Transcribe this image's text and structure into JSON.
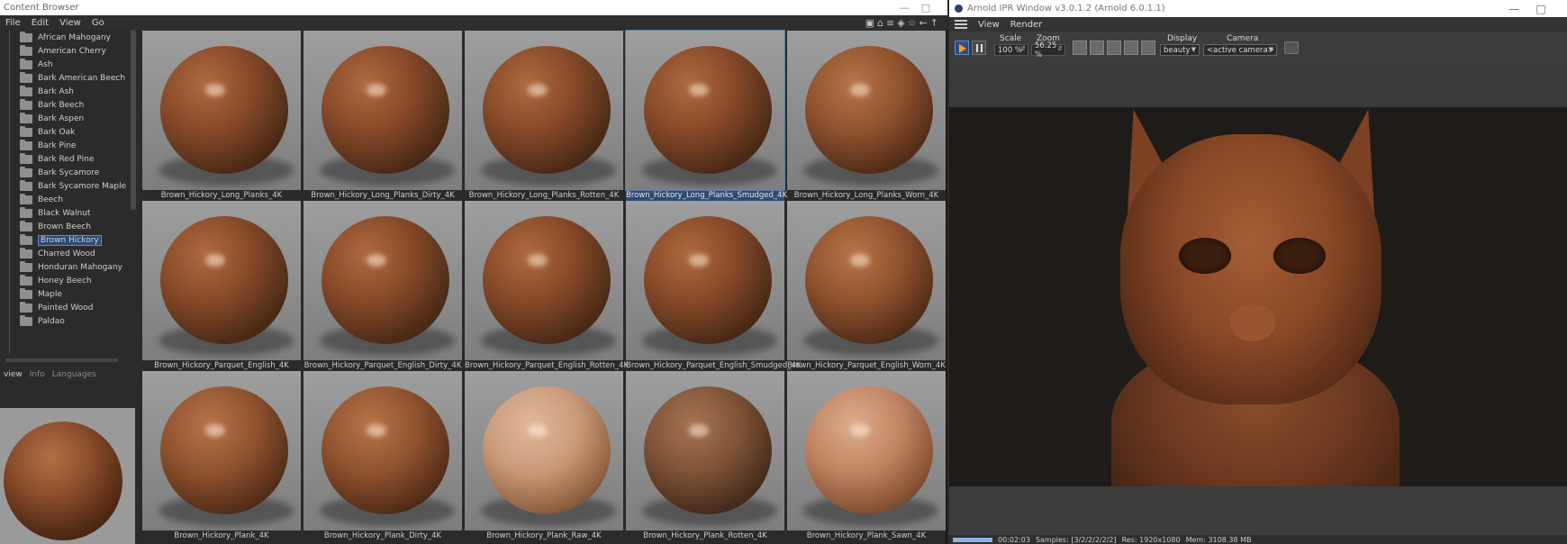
{
  "content_browser": {
    "title": "Content Browser",
    "menu": [
      "File",
      "Edit",
      "View",
      "Go"
    ],
    "tree_items": [
      {
        "label": "African Mahogany",
        "selected": false
      },
      {
        "label": "American Cherry",
        "selected": false
      },
      {
        "label": "Ash",
        "selected": false
      },
      {
        "label": "Bark American Beech",
        "selected": false
      },
      {
        "label": "Bark Ash",
        "selected": false
      },
      {
        "label": "Bark Beech",
        "selected": false
      },
      {
        "label": "Bark Aspen",
        "selected": false
      },
      {
        "label": "Bark Oak",
        "selected": false
      },
      {
        "label": "Bark Pine",
        "selected": false
      },
      {
        "label": "Bark Red Pine",
        "selected": false
      },
      {
        "label": "Bark Sycamore",
        "selected": false
      },
      {
        "label": "Bark Sycamore Maple",
        "selected": false
      },
      {
        "label": "Beech",
        "selected": false
      },
      {
        "label": "Black Walnut",
        "selected": false
      },
      {
        "label": "Brown Beech",
        "selected": false
      },
      {
        "label": "Brown Hickory",
        "selected": true
      },
      {
        "label": "Charred Wood",
        "selected": false
      },
      {
        "label": "Honduran Mahogany",
        "selected": false
      },
      {
        "label": "Honey Beech",
        "selected": false
      },
      {
        "label": "Maple",
        "selected": false
      },
      {
        "label": "Painted Wood",
        "selected": false
      },
      {
        "label": "Paldao",
        "selected": false
      }
    ],
    "panel_tabs": [
      "view",
      "Info",
      "Languages"
    ],
    "assets": [
      {
        "name": "Brown_Hickory_Long_Planks_4K",
        "selected": false,
        "tone": "dark"
      },
      {
        "name": "Brown_Hickory_Long_Planks_Dirty_4K",
        "selected": false,
        "tone": "dark"
      },
      {
        "name": "Brown_Hickory_Long_Planks_Rotten_4K",
        "selected": false,
        "tone": "dark"
      },
      {
        "name": "Brown_Hickory_Long_Planks_Smudged_4K",
        "selected": true,
        "tone": "dark"
      },
      {
        "name": "Brown_Hickory_Long_Planks_Worn_4K",
        "selected": false,
        "tone": "mid"
      },
      {
        "name": "Brown_Hickory_Parquet_English_4K",
        "selected": false,
        "tone": "dark"
      },
      {
        "name": "Brown_Hickory_Parquet_English_Dirty_4K",
        "selected": false,
        "tone": "dark"
      },
      {
        "name": "Brown_Hickory_Parquet_English_Rotten_4K",
        "selected": false,
        "tone": "dark"
      },
      {
        "name": "Brown_Hickory_Parquet_English_Smudged_4K",
        "selected": false,
        "tone": "dark"
      },
      {
        "name": "Brown_Hickory_Parquet_English_Worn_4K",
        "selected": false,
        "tone": "mid"
      },
      {
        "name": "Brown_Hickory_Plank_4K",
        "selected": false,
        "tone": "mid"
      },
      {
        "name": "Brown_Hickory_Plank_Dirty_4K",
        "selected": false,
        "tone": "mid"
      },
      {
        "name": "Brown_Hickory_Plank_Raw_4K",
        "selected": false,
        "tone": "raw"
      },
      {
        "name": "Brown_Hickory_Plank_Rotten_4K",
        "selected": false,
        "tone": "rot"
      },
      {
        "name": "Brown_Hickory_Plank_Sawn_4K",
        "selected": false,
        "tone": "light"
      }
    ]
  },
  "ipr": {
    "title": "Arnold IPR Window v3.0.1.2 (Arnold 6.0.1.1)",
    "menu": [
      "View",
      "Render"
    ],
    "scale_label": "Scale",
    "scale_value": "100 %",
    "zoom_label": "Zoom",
    "zoom_value": "56.25 %",
    "display_label": "Display",
    "display_value": "beauty",
    "camera_label": "Camera",
    "camera_value": "<active camera>",
    "status": {
      "progress": 1.0,
      "time": "00:02:03",
      "samples": "Samples: [3/2/2/2/2/2]",
      "res": "Res: 1920x1080",
      "mem": "Mem: 3108.38 MB"
    }
  },
  "colors": {
    "selection": "#2f4a73",
    "accent_play": "#ff9a1e"
  }
}
